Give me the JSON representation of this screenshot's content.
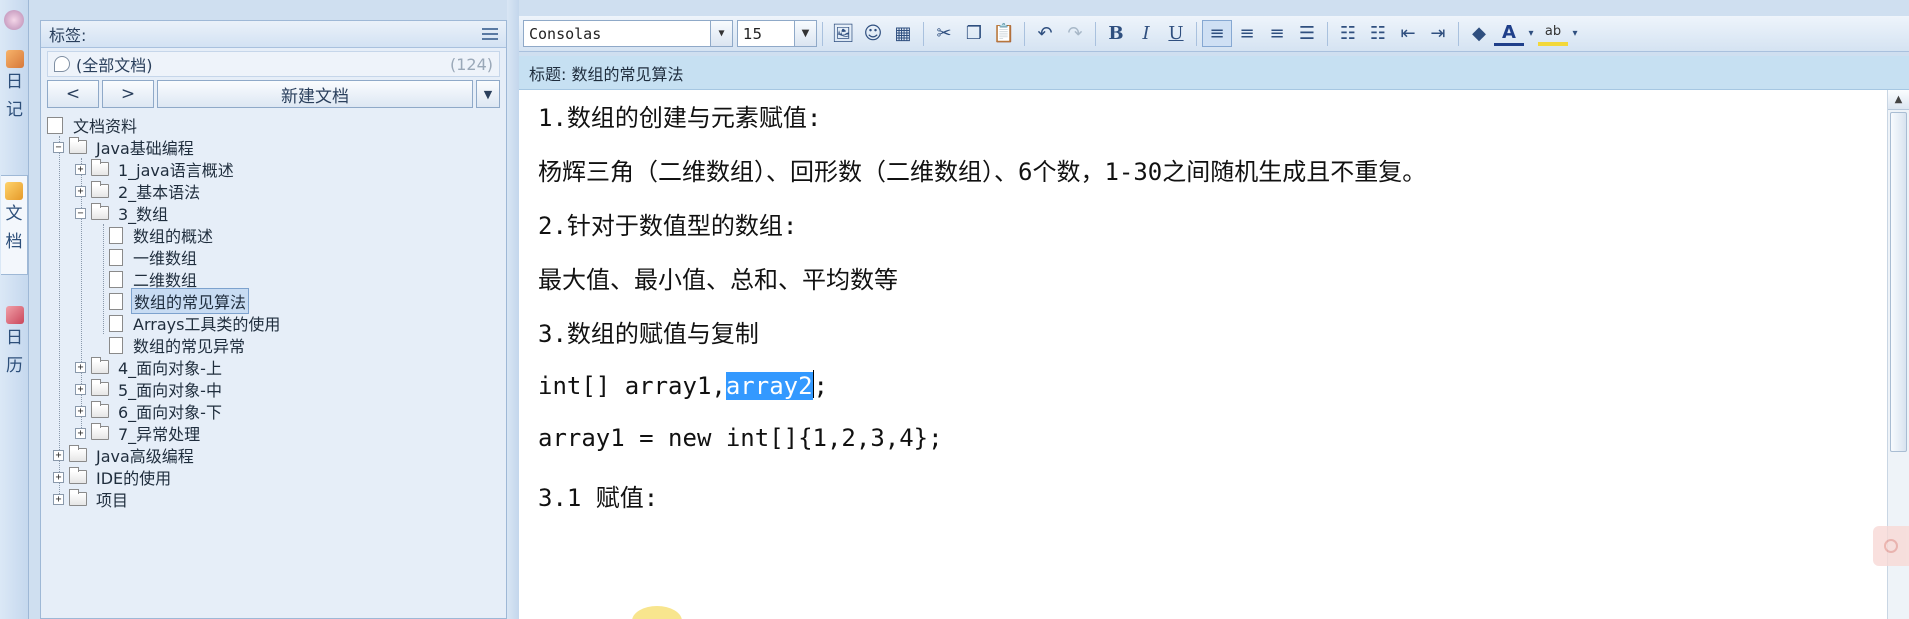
{
  "nav": {
    "items": [
      {
        "label": "日\n记",
        "icon": "pencil-icon"
      },
      {
        "label": "文\n档",
        "icon": "documents-icon"
      },
      {
        "label": "日\n历",
        "icon": "calendar-icon"
      }
    ]
  },
  "tags": {
    "header": "标签:",
    "all_docs_label": "(全部文档)",
    "all_docs_count": "(124)"
  },
  "nav_buttons": {
    "back": "<",
    "forward": ">",
    "new_doc": "新建文档",
    "dropdown": "▼"
  },
  "tree": {
    "root": "文档资料",
    "java_basic": "Java基础编程",
    "items": [
      "1_java语言概述",
      "2_基本语法",
      "3_数组",
      "数组的概述",
      "一维数组",
      "二维数组",
      "数组的常见算法",
      "Arrays工具类的使用",
      "数组的常见异常",
      "4_面向对象-上",
      "5_面向对象-中",
      "6_面向对象-下",
      "7_异常处理"
    ],
    "java_advanced": "Java高级编程",
    "ide": "IDE的使用",
    "project": "项目",
    "selected": "数组的常见算法"
  },
  "toolbar": {
    "font": "Consolas",
    "size": "15",
    "bold": "B",
    "italic": "I",
    "underline": "U"
  },
  "title": {
    "text": "标题: 数组的常见算法"
  },
  "editor": {
    "lines": [
      "1.数组的创建与元素赋值:",
      "杨辉三角（二维数组）、回形数（二维数组）、6个数，1-30之间随机生成且不重复。",
      "2.针对于数值型的数组:",
      "最大值、最小值、总和、平均数等",
      "3.数组的赋值与复制",
      "int[] array1,",
      "array2",
      ";",
      "array1 = new int[]{1,2,3,4};",
      "3.1 赋值:"
    ]
  },
  "colors": {
    "selection": "#3399ff",
    "title_bar": "#c6e0f2",
    "panel": "#e6eef8"
  }
}
